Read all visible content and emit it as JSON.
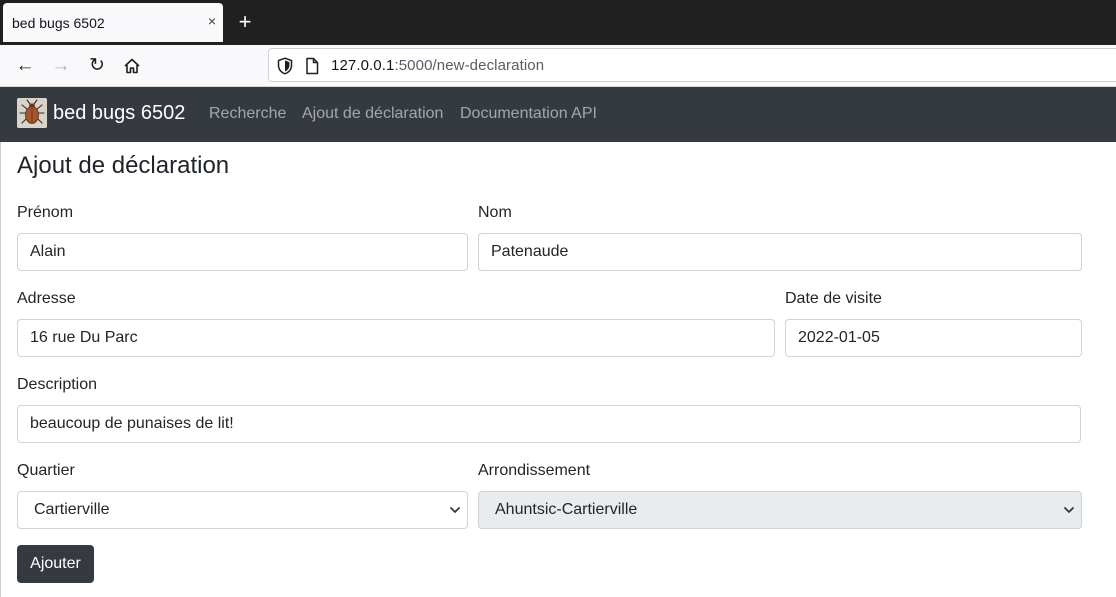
{
  "browser": {
    "tab_title": "bed bugs 6502",
    "tab_close_glyph": "×",
    "new_tab_glyph": "+",
    "back_glyph": "←",
    "forward_glyph": "→",
    "reload_glyph": "↻",
    "url_host": "127.0.0.1",
    "url_rest": ":5000/new-declaration",
    "icons": [
      "close-icon",
      "plus-icon",
      "back-arrow-icon",
      "forward-arrow-icon",
      "reload-icon",
      "home-icon",
      "shield-icon",
      "page-icon"
    ]
  },
  "site": {
    "brand": "bed bugs 6502",
    "nav": [
      "Recherche",
      "Ajout de déclaration",
      "Documentation API"
    ],
    "colors": {
      "navbar": "#343a40",
      "button": "#343a40"
    }
  },
  "form": {
    "title": "Ajout de déclaration",
    "prenom_label": "Prénom",
    "prenom_value": "Alain",
    "nom_label": "Nom",
    "nom_value": "Patenaude",
    "adresse_label": "Adresse",
    "adresse_value": "16 rue Du Parc",
    "date_label": "Date de visite",
    "date_value": "2022-01-05",
    "description_label": "Description",
    "description_value": "beaucoup de punaises de lit!",
    "quartier_label": "Quartier",
    "quartier_value": "Cartierville",
    "arrondissement_label": "Arrondissement",
    "arrondissement_value": "Ahuntsic-Cartierville",
    "submit_label": "Ajouter"
  }
}
